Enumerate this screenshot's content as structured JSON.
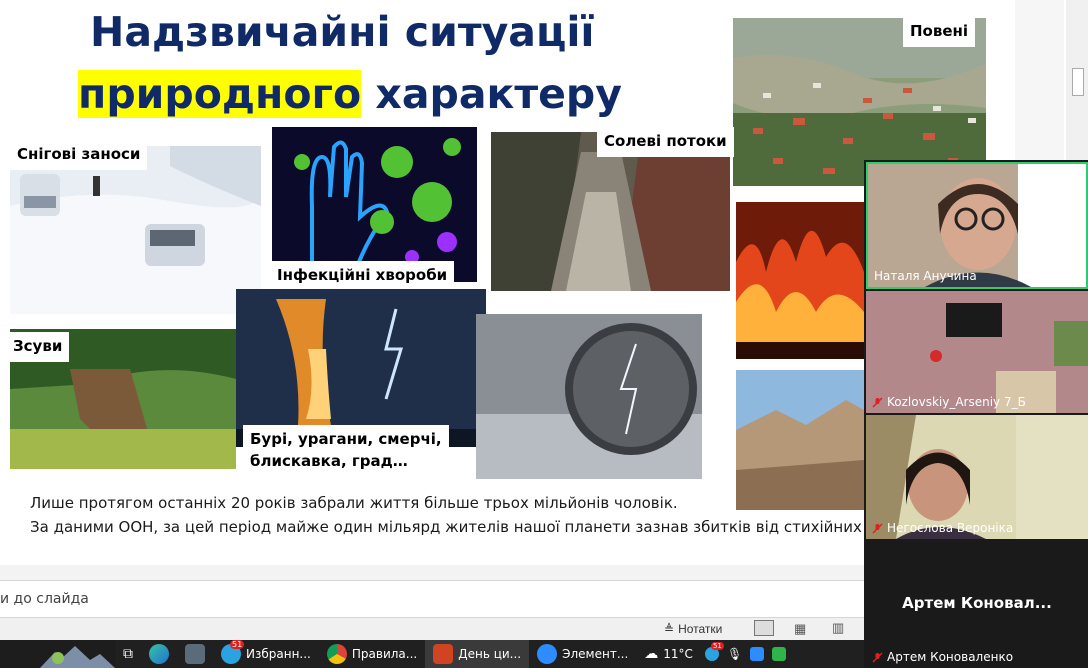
{
  "slide": {
    "title_line1": "Надзвичайні ситуації",
    "title_line2_highlight": "природного",
    "title_line2_rest": " характеру",
    "labels": {
      "floods": "Повені",
      "snow": "Снігові заноси",
      "infection": "Інфекційні хвороби",
      "mudflows": "Солеві потоки",
      "landslides": "Зсуви",
      "storms": "Бурі, урагани, смерчі,\nблискавка, град…"
    },
    "text_line1": "Лише протягом останніх 20 років забрали життя більше трьох мільйонів чоловік.",
    "text_line2": "За даними ООН, за цей період майже один мільярд жителів нашої планети зазнав збитків від стихійних"
  },
  "powerpoint": {
    "notes_placeholder": "и до слайда",
    "notes_button": "Нотатки"
  },
  "zoom": {
    "participants": [
      {
        "name": "Наталя Анучина",
        "muted": false
      },
      {
        "name": "Kozlovskiy_Arseniy 7_Б",
        "muted": true
      },
      {
        "name": "Негоєлова Вероніка",
        "muted": true
      },
      {
        "name": "Артем Коноваленко",
        "muted": true,
        "no_video_label": "Артем  Коновал..."
      }
    ]
  },
  "taskbar": {
    "apps": [
      {
        "label": "",
        "icon": "edge-icon"
      },
      {
        "label": "",
        "icon": "calculator-icon"
      },
      {
        "label": "Избранн...",
        "icon": "telegram-icon",
        "badge": "51"
      },
      {
        "label": "Правила...",
        "icon": "chrome-icon"
      },
      {
        "label": "День ци...",
        "icon": "powerpoint-icon"
      },
      {
        "label": "Элемент...",
        "icon": "zoom-icon"
      }
    ],
    "weather": "11°C",
    "tray_badge": "51"
  },
  "colors": {
    "title": "#0f2a66",
    "highlight": "#ffff00",
    "active_speaker_border": "#2ecc71",
    "muted_red": "#e02020"
  }
}
